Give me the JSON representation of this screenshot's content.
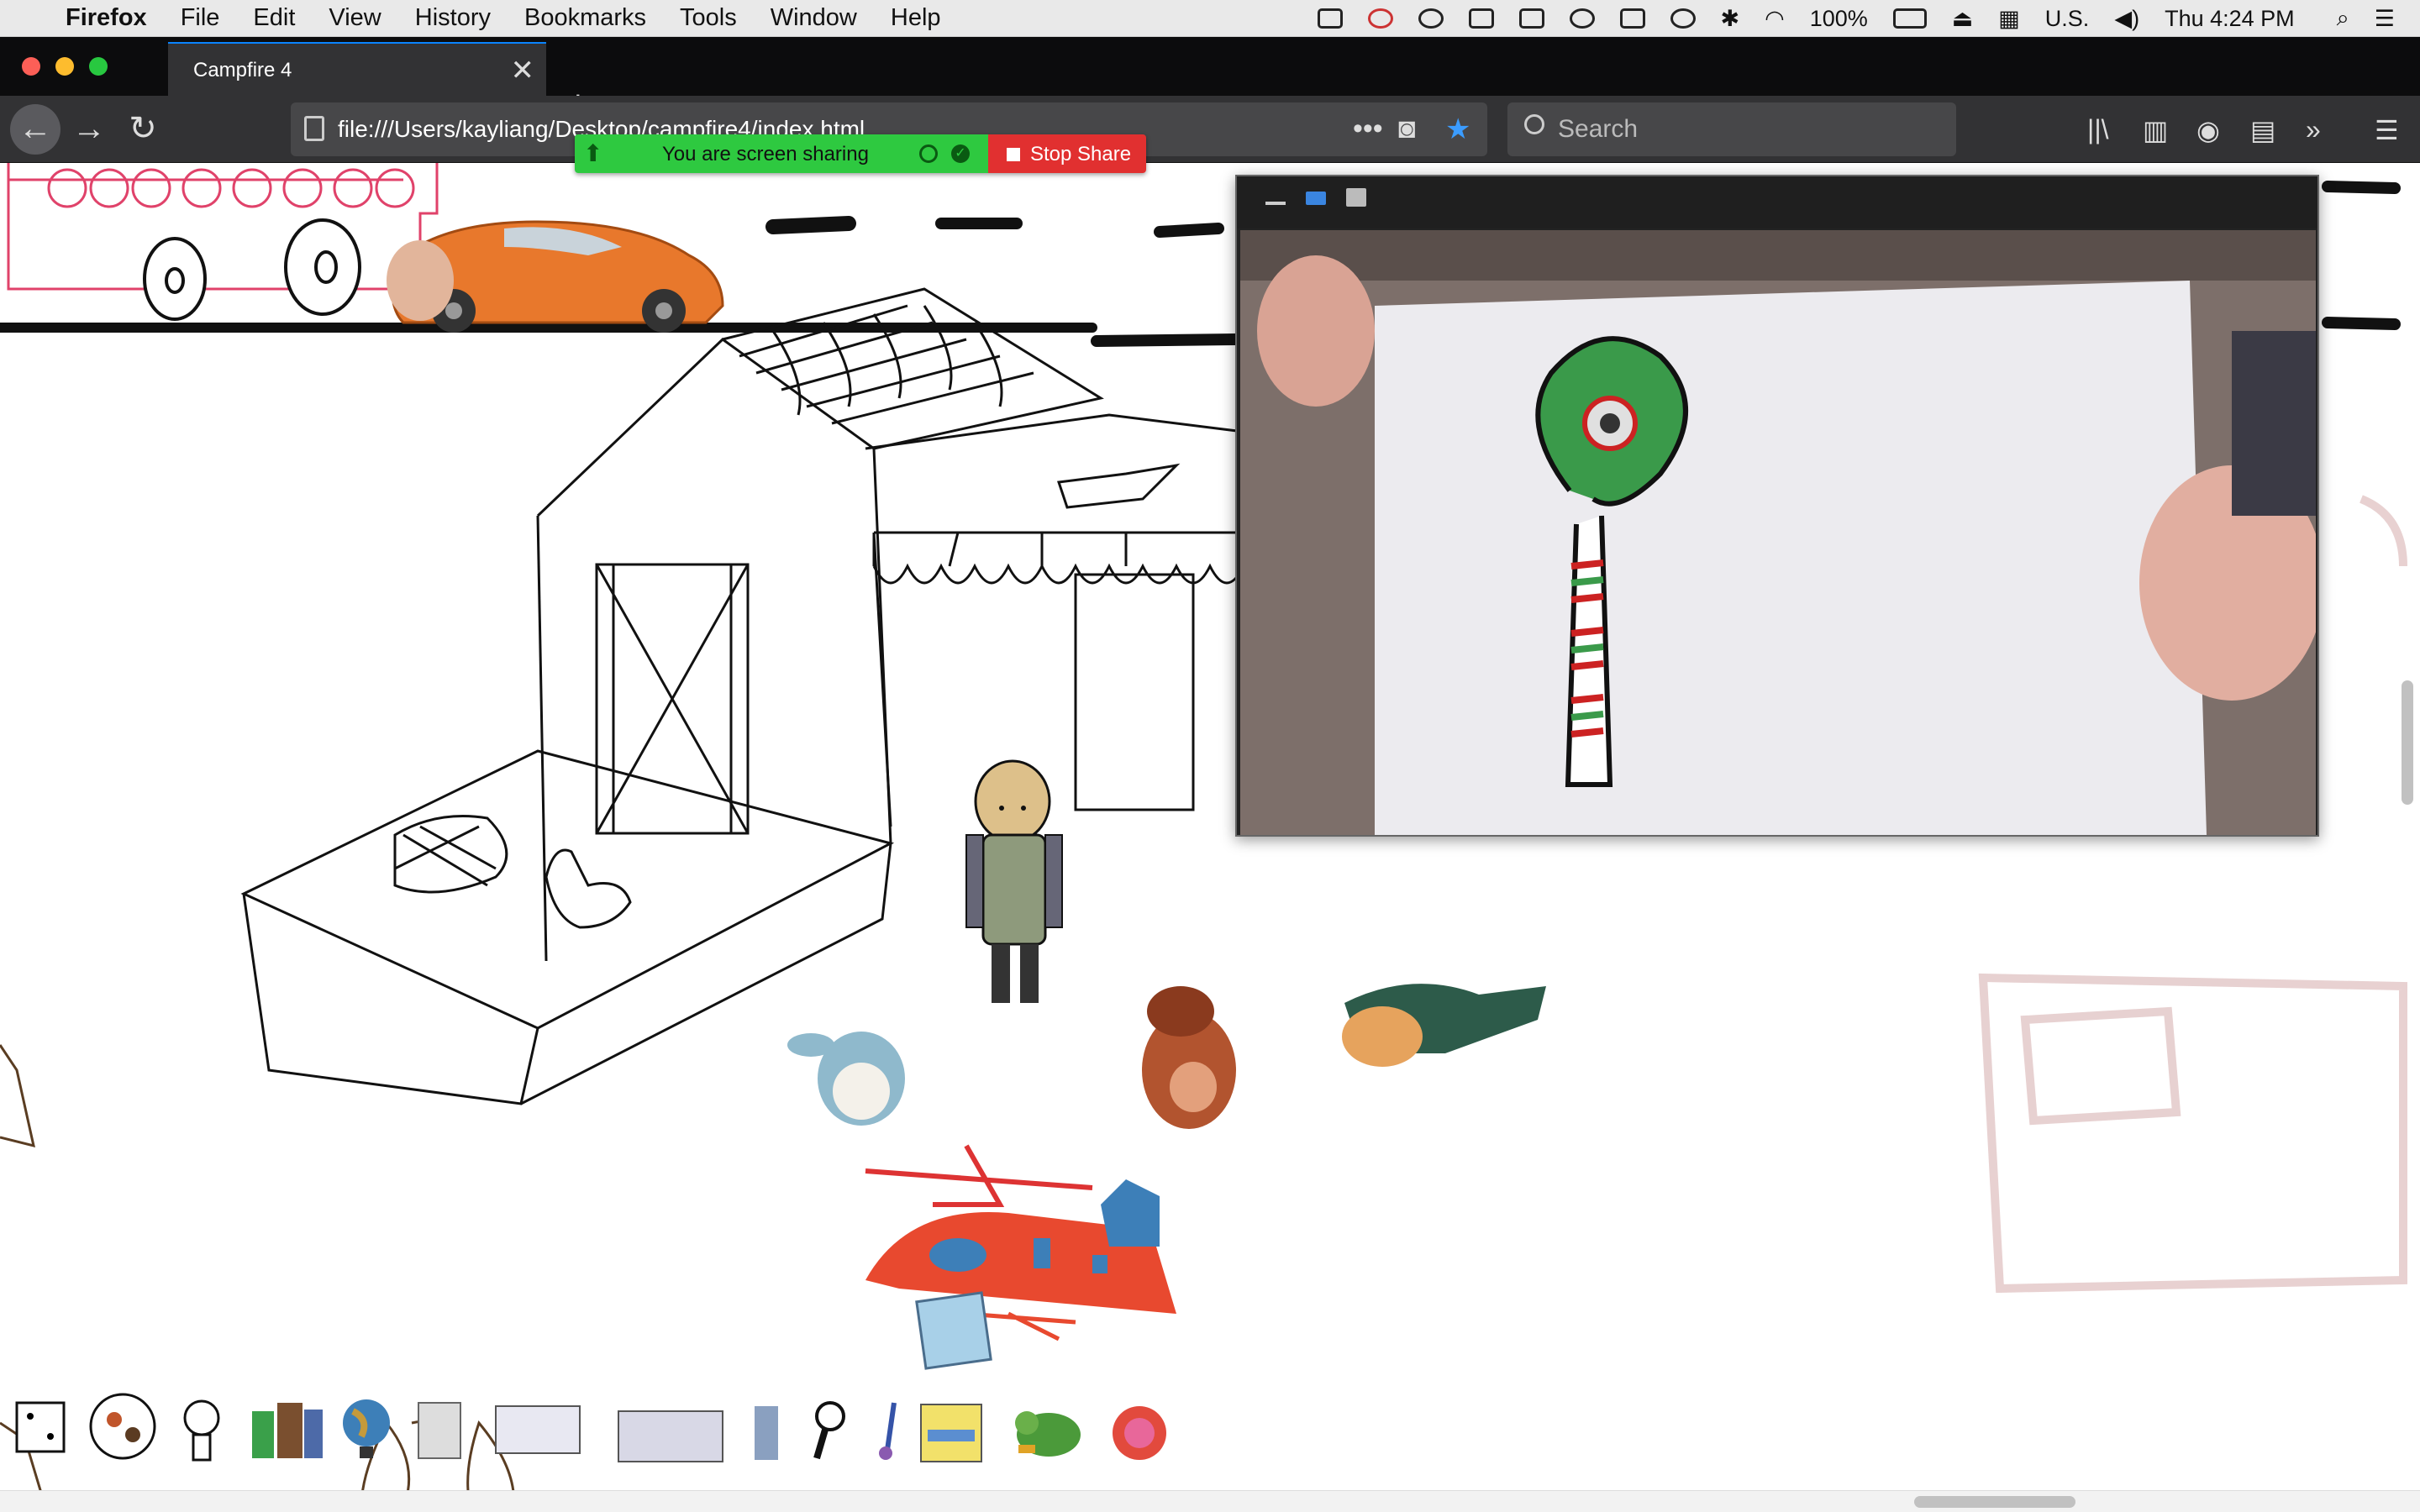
{
  "menubar": {
    "app_name": "Firefox",
    "menus": [
      "File",
      "Edit",
      "View",
      "History",
      "Bookmarks",
      "Tools",
      "Window",
      "Help"
    ],
    "battery": "100%",
    "input_source": "U.S.",
    "clock": "Thu 4:24 PM"
  },
  "browser": {
    "tab_title": "Campfire 4",
    "url": "file:///Users/kayliang/Desktop/campfire4/index.html",
    "search_placeholder": "Search"
  },
  "screen_share": {
    "status_label": "You are screen sharing",
    "stop_label": "Stop Share",
    "green": "#2ec940",
    "red": "#e13030"
  },
  "colors": {
    "accent": "#0a84ff",
    "toolbar_bg": "#323234",
    "tabstrip_bg": "#0c0c0d"
  },
  "canvas_items": [
    "bus-drawing",
    "toy-car",
    "barn-drawing",
    "shop-drawing",
    "farmer-character",
    "chicken-drawing",
    "plush-toy",
    "squirrel-toy",
    "dinosaur-toy",
    "helicopter-drawing"
  ],
  "bottom_tray_items": [
    "dice",
    "spinner",
    "lightbulb",
    "bottles",
    "globe",
    "book",
    "card",
    "card-2",
    "bottle",
    "magnifier",
    "paintbrush",
    "notepad",
    "turtle-toy",
    "planet"
  ]
}
